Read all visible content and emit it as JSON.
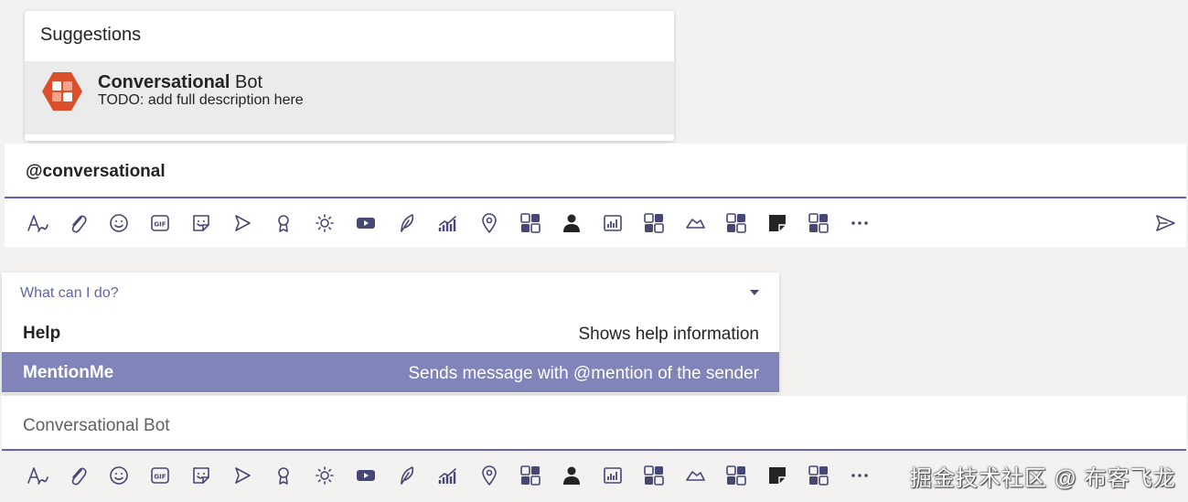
{
  "suggestions": {
    "title": "Suggestions",
    "item": {
      "name_bold": "Conversational",
      "name_rest": " Bot",
      "description": "TODO: add full description here",
      "logo_color": "#dc4f2b"
    }
  },
  "composer_top": {
    "text": "@conversational"
  },
  "commands": {
    "header": "What can I do?",
    "items": [
      {
        "name": "Help",
        "description": "Shows help information"
      },
      {
        "name": "MentionMe",
        "description": "Sends message with @mention of the sender"
      }
    ]
  },
  "composer_bottom": {
    "text": "Conversational Bot"
  },
  "toolbar_icons": [
    "format-icon",
    "attach-icon",
    "emoji-icon",
    "gif-icon",
    "sticker-icon",
    "meet-now-icon",
    "praise-icon",
    "bulb-icon",
    "video-icon",
    "feather-icon",
    "chart-icon",
    "location-icon",
    "app-grid-icon",
    "person-icon",
    "analytics-icon",
    "app-grid-icon",
    "cloud-icon",
    "app-grid-icon",
    "note-icon",
    "app-grid-icon",
    "more-icon"
  ],
  "colors": {
    "accent": "#6264a7",
    "selected_row": "#8184b9"
  },
  "watermark": "掘金技术社区 @ 布客飞龙"
}
